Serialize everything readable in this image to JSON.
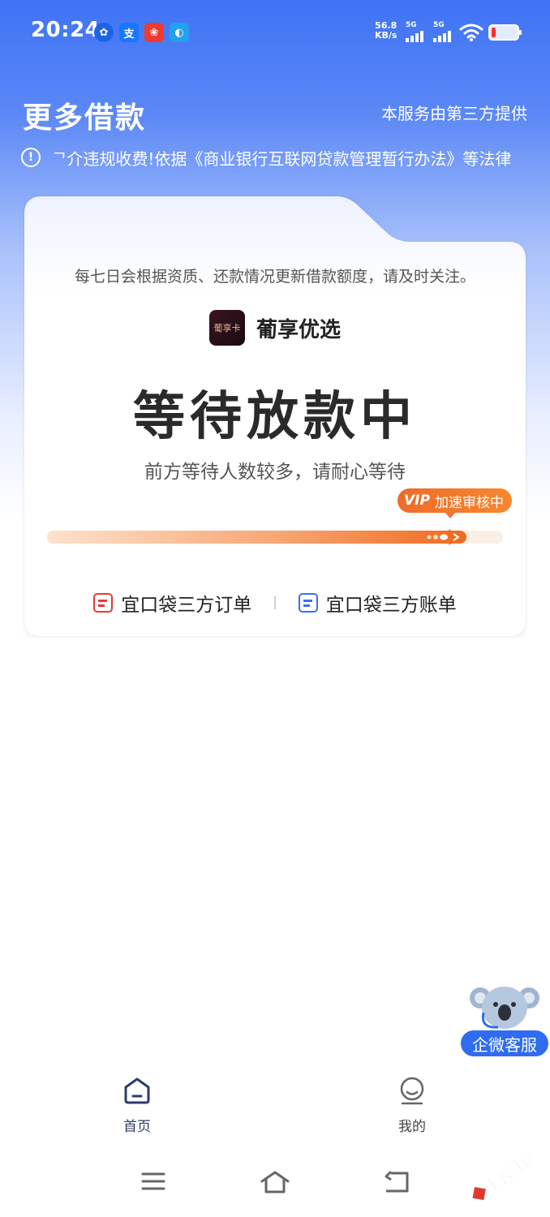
{
  "status_bar": {
    "time": "20:24",
    "app_icons": [
      {
        "name": "browser-app-icon",
        "glyph": "✿"
      },
      {
        "name": "alipay-app-icon",
        "glyph": "支"
      },
      {
        "name": "pinduoduo-app-icon",
        "glyph": "❀"
      },
      {
        "name": "cloud-app-icon",
        "glyph": "◐"
      }
    ],
    "net_speed_value": "56.8",
    "net_speed_unit": "KB/s",
    "signal1_label": "5G",
    "signal2_label": "5G",
    "battery_color": "#ff2d2d"
  },
  "header": {
    "title": "更多借款",
    "provider_note": "本服务由第三方提供",
    "notice_text": "ᄀ介违规收费!依据《商业银行互联网贷款管理暂行办法》等法律"
  },
  "card": {
    "description": "每七日会根据资质、还款情况更新借款额度，请及时关注。",
    "brand_logo_text": "葡享卡",
    "brand_name": "葡享优选",
    "status_title": "等待放款中",
    "status_subtitle": "前方等待人数较多，请耐心等待",
    "vip_mark": "VIP",
    "vip_text": "加速审核中",
    "progress_fraction": 0.92,
    "links": [
      {
        "label": "宜口袋三方订单",
        "icon": "order-icon",
        "color": "#e8383d"
      },
      {
        "label": "宜口袋三方账单",
        "icon": "bill-icon",
        "color": "#3b6ff0"
      }
    ]
  },
  "floating_service": {
    "label": "企微客服",
    "icon": "koala-mascot-icon"
  },
  "tabbar": {
    "tabs": [
      {
        "label": "首页",
        "icon": "home-icon",
        "active": true
      },
      {
        "label": "我的",
        "icon": "profile-icon",
        "active": false
      }
    ]
  },
  "watermark": {
    "text": "卡农社区"
  },
  "colors": {
    "primary_blue": "#3f73f5",
    "accent_orange": "#ef6a1f",
    "text_dark": "#2a2a2a"
  }
}
